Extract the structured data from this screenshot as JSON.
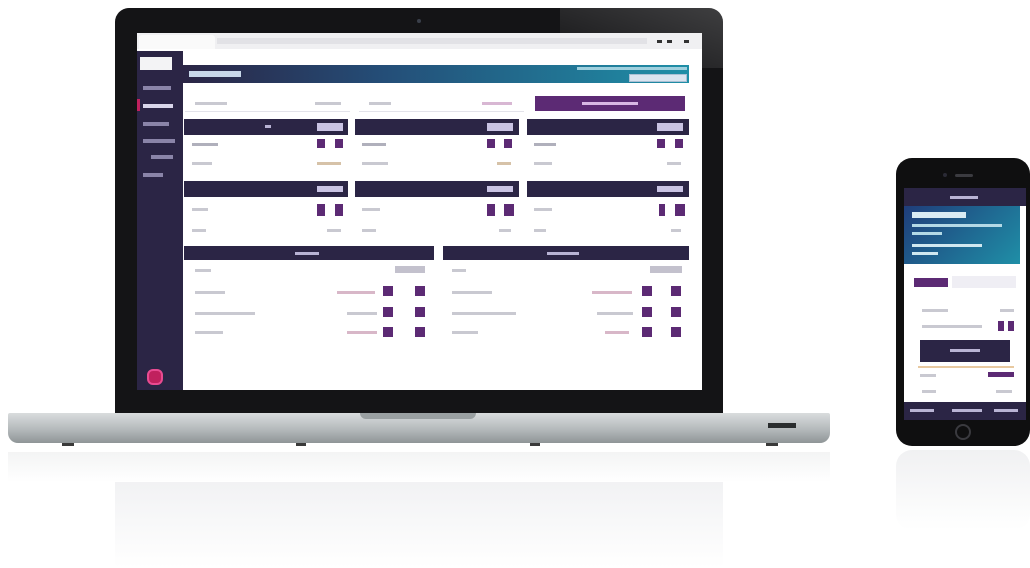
{
  "colors": {
    "brand_dark": "#2b2545",
    "brand_purple": "#5c2a74",
    "brand_magenta": "#c0215e",
    "brand_teal": "#1f8fa7",
    "laptop_body": "#1a1a1c",
    "laptop_base": "#b9bdbe"
  },
  "icons": {
    "camera": "laptop-camera-icon",
    "brand_logo": "brand-logo-icon",
    "window_min": "minimize-icon",
    "window_max": "maximize-icon",
    "window_close": "close-icon",
    "phone_home": "phone-home-button-icon"
  },
  "laptop": {
    "sidebar_items": [
      "",
      "",
      "",
      "",
      "",
      ""
    ],
    "top_panels": [
      "",
      "",
      ""
    ],
    "mid_panels": [
      "",
      "",
      ""
    ],
    "bottom_tables": [
      "",
      ""
    ]
  },
  "phone": {
    "rows": [
      "",
      "",
      "",
      ""
    ]
  }
}
